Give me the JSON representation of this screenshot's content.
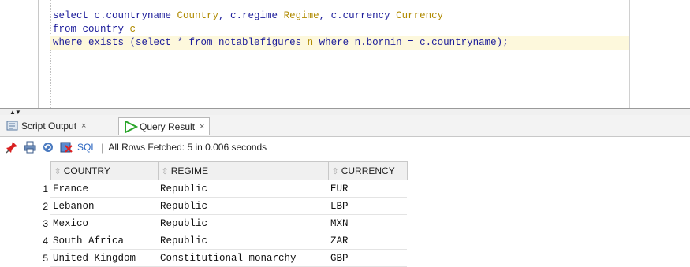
{
  "editor": {
    "lines": [
      [
        {
          "t": "select c.countryname ",
          "c": "kw"
        },
        {
          "t": "Country",
          "c": "alias"
        },
        {
          "t": ", c.regime ",
          "c": "kw"
        },
        {
          "t": "Regime",
          "c": "alias"
        },
        {
          "t": ", c.currency ",
          "c": "kw"
        },
        {
          "t": "Currency",
          "c": "alias"
        }
      ],
      [
        {
          "t": "from country ",
          "c": "kw"
        },
        {
          "t": "c",
          "c": "alias"
        }
      ],
      [
        {
          "t": "where exists (select ",
          "c": "kw"
        },
        {
          "t": "*",
          "c": "star"
        },
        {
          "t": " from notablefigures ",
          "c": "kw"
        },
        {
          "t": "n",
          "c": "alias"
        },
        {
          "t": " where n.bornin = c.countryname);",
          "c": "kw"
        }
      ]
    ],
    "highlighted_line": 2
  },
  "tabs": [
    {
      "label": "Script Output",
      "close": "×",
      "icon": "script-output-icon",
      "active": false
    },
    {
      "label": "Query Result",
      "close": "×",
      "icon": "run-arrow-icon",
      "active": true
    }
  ],
  "toolbar": {
    "icons": [
      "pin-icon",
      "print-icon",
      "refresh-icon",
      "delete-icon"
    ],
    "sql_label": "SQL",
    "separator": "|",
    "status": "All Rows Fetched: 5 in 0.006 seconds"
  },
  "results": {
    "columns": [
      "COUNTRY",
      "REGIME",
      "CURRENCY"
    ],
    "rows": [
      {
        "n": "1",
        "cells": [
          "France",
          "Republic",
          "EUR"
        ]
      },
      {
        "n": "2",
        "cells": [
          "Lebanon",
          "Republic",
          "LBP"
        ]
      },
      {
        "n": "3",
        "cells": [
          "Mexico",
          "Republic",
          "MXN"
        ]
      },
      {
        "n": "4",
        "cells": [
          "South Africa",
          "Republic",
          "ZAR"
        ]
      },
      {
        "n": "5",
        "cells": [
          "United Kingdom",
          "Constitutional monarchy",
          "GBP"
        ]
      }
    ]
  },
  "colors": {
    "keyword": "#1c1c9a",
    "alias": "#b08a00",
    "line_highlight": "#fdf8dc",
    "run_arrow": "#2aa52a"
  }
}
